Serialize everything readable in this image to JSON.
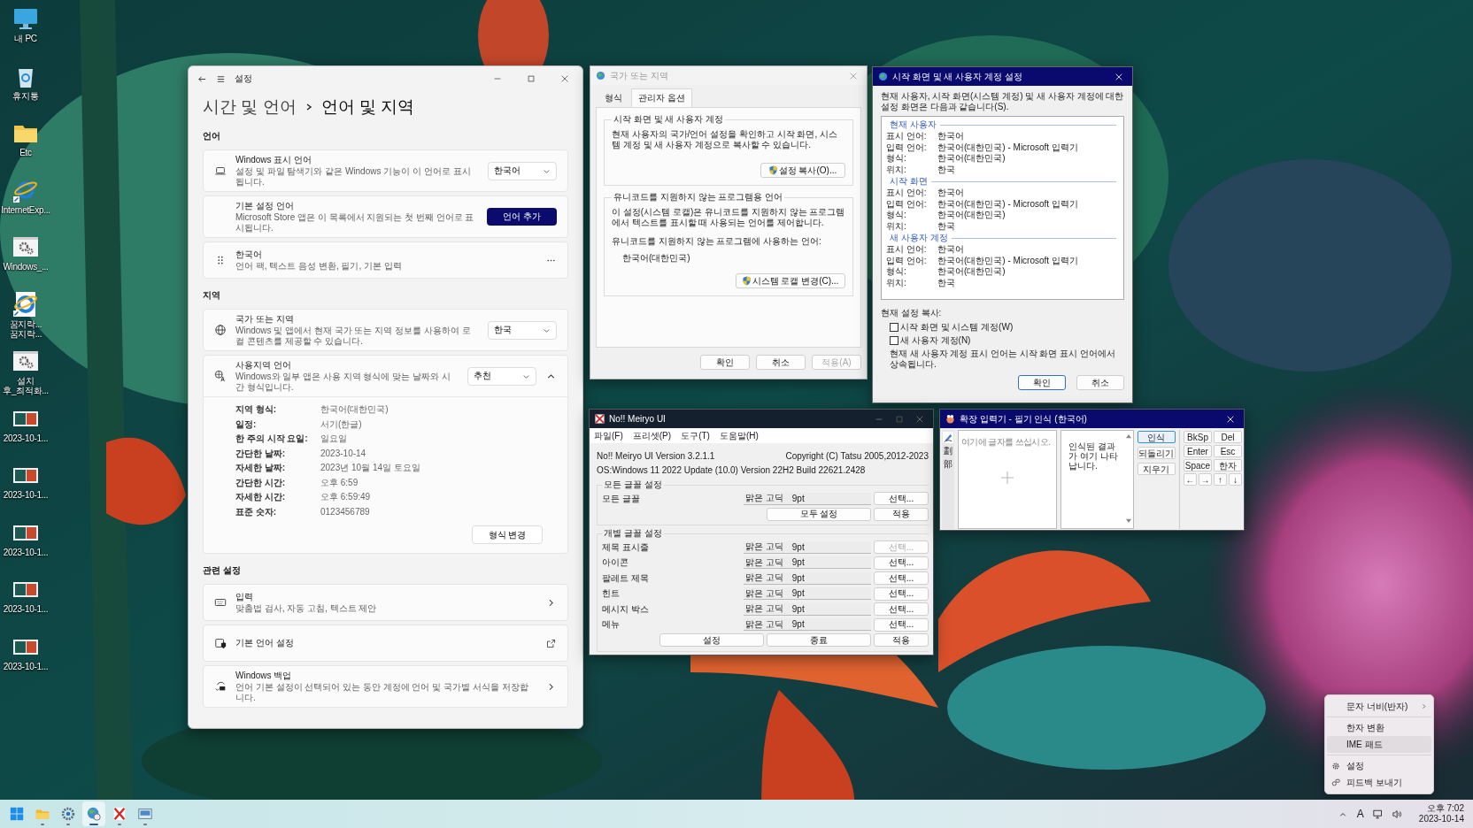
{
  "desktop_icons": [
    {
      "kind": "pc",
      "lines": [
        "내 PC"
      ]
    },
    {
      "kind": "bin",
      "lines": [
        "휴지통"
      ]
    },
    {
      "kind": "folder",
      "lines": [
        "Etc"
      ]
    },
    {
      "kind": "ie",
      "lines": [
        "InternetExp..."
      ]
    },
    {
      "kind": "gear",
      "lines": [
        "Windows_..."
      ]
    },
    {
      "kind": "iedoc",
      "lines": [
        "꿈지락...",
        "꿈지락..."
      ]
    },
    {
      "kind": "gear",
      "lines": [
        "설치",
        "후_최적화..."
      ]
    },
    {
      "kind": "shot",
      "lines": [
        "2023-10-1..."
      ]
    },
    {
      "kind": "shot",
      "lines": [
        "2023-10-1..."
      ]
    },
    {
      "kind": "shot",
      "lines": [
        "2023-10-1..."
      ]
    },
    {
      "kind": "shot",
      "lines": [
        "2023-10-1..."
      ]
    },
    {
      "kind": "shot",
      "lines": [
        "2023-10-1..."
      ]
    }
  ],
  "settings": {
    "title": "설정",
    "breadcrumb": "시간 및 언어",
    "page_title": "언어 및 지역",
    "sections": [
      {
        "heading": "언어",
        "cards": [
          {
            "kind": "dropdown",
            "title": "Windows 표시 언어",
            "desc": "설정 및 파일 탐색기와 같은 Windows 기능이 이 언어로 표시됩니다.",
            "value": "한국어"
          },
          {
            "kind": "button",
            "title": "기본 설정 언어",
            "desc": "Microsoft Store 앱은 이 목록에서 지원되는 첫 번째 언어로 표시됩니다.",
            "button": "언어 추가"
          },
          {
            "kind": "menu",
            "title": "한국어",
            "desc": "언어 팩, 텍스트 음성 변환, 필기, 기본 입력"
          }
        ]
      },
      {
        "heading": "지역",
        "cards": [
          {
            "kind": "dropdown",
            "title": "국가 또는 지역",
            "desc": "Windows 및 앱에서 현재 국가 또는 지역 정보를 사용하여 로컬 콘텐츠를 제공할 수 있습니다.",
            "value": "한국"
          },
          {
            "kind": "expander",
            "title": "사용지역 언어",
            "desc": "Windows와 일부 앱은 사용 지역 형식에 맞는 날짜와 시간 형식입니다.",
            "value": "추천",
            "expanded": true,
            "button": "형식 변경",
            "details": [
              {
                "label": "지역 형식:",
                "value": "한국어(대한민국)"
              },
              {
                "label": "일정:",
                "value": "서기(한글)"
              },
              {
                "label": "한 주의 시작 요일:",
                "value": "일요일"
              },
              {
                "label": "간단한 날짜:",
                "value": "2023-10-14"
              },
              {
                "label": "자세한 날짜:",
                "value": "2023년 10월 14일 토요일"
              },
              {
                "label": "간단한 시간:",
                "value": "오후 6:59"
              },
              {
                "label": "자세한 시간:",
                "value": "오후 6:59:49"
              },
              {
                "label": "표준 숫자:",
                "value": "0123456789"
              }
            ]
          }
        ]
      },
      {
        "heading": "관련 설정",
        "cards": [
          {
            "kind": "link",
            "title": "입력",
            "desc": "맞춤법 검사, 자동 고침, 텍스트 제안"
          },
          {
            "kind": "external",
            "title": "기본 언어 설정"
          },
          {
            "kind": "link",
            "title": "Windows 백업",
            "desc": "언어 기본 설정이 선택되어 있는 동안 계정에 언어 및 국가별 서식을 저장합니다."
          }
        ]
      }
    ]
  },
  "region_dialog": {
    "title": "국가 또는 지역",
    "tabs": [
      {
        "label": "형식",
        "selected": false
      },
      {
        "label": "관리자 옵션",
        "selected": true
      }
    ],
    "group1": {
      "title": "시작 화면 및 새 사용자 계정",
      "text": "현재 사용자의 국가/언어 설정을 확인하고 시작 화면, 시스템 계정 및 새 사용자 계정으로 복사할 수 있습니다.",
      "button": "설정 복사(O)..."
    },
    "group2": {
      "title": "유니코드를 지원하지 않는 프로그램용 언어",
      "text": "이 설정(시스템 로캘)은 유니코드를 지원하지 않는 프로그램에서 텍스트를 표시할 때 사용되는 언어를 제어합니다.",
      "label": "유니코드를 지원하지 않는 프로그램에 사용하는 언어:",
      "value": "한국어(대한민국)",
      "button": "시스템 로캘 변경(C)..."
    },
    "buttons": [
      {
        "label": "확인",
        "disabled": false
      },
      {
        "label": "취소",
        "disabled": false
      },
      {
        "label": "적용(A)",
        "disabled": true
      }
    ]
  },
  "start_dialog": {
    "title": "시작 화면 및 새 사용자 계정 설정",
    "intro": "현재 사용자, 시작 화면(시스템 계정) 및 새 사용자 계정에 대한 설정 화면은 다음과 같습니다(S).",
    "sections": [
      {
        "heading": "현재 사용자",
        "rows": [
          {
            "label": "표시 언어:",
            "value": "한국어"
          },
          {
            "label": "입력 언어:",
            "value": "한국어(대한민국) - Microsoft 입력기"
          },
          {
            "label": "형식:",
            "value": "한국어(대한민국)"
          },
          {
            "label": "위치:",
            "value": "한국"
          }
        ]
      },
      {
        "heading": "시작 화면",
        "rows": [
          {
            "label": "표시 언어:",
            "value": "한국어"
          },
          {
            "label": "입력 언어:",
            "value": "한국어(대한민국) - Microsoft 입력기"
          },
          {
            "label": "형식:",
            "value": "한국어(대한민국)"
          },
          {
            "label": "위치:",
            "value": "한국"
          }
        ]
      },
      {
        "heading": "새 사용자 계정",
        "rows": [
          {
            "label": "표시 언어:",
            "value": "한국어"
          },
          {
            "label": "입력 언어:",
            "value": "한국어(대한민국) - Microsoft 입력기"
          },
          {
            "label": "형식:",
            "value": "한국어(대한민국)"
          },
          {
            "label": "위치:",
            "value": "한국"
          }
        ]
      }
    ],
    "copy_label": "현재 설정 복사:",
    "checkboxes": [
      {
        "label": "시작 화면 및 시스템 계정(W)",
        "checked": false
      },
      {
        "label": "새 사용자 계정(N)",
        "checked": false
      }
    ],
    "note": "현재 새 사용자 계정 표시 언어는 시작 화면 표시 언어에서 상속됩니다.",
    "buttons": [
      {
        "label": "확인",
        "default": true
      },
      {
        "label": "취소",
        "default": false
      }
    ]
  },
  "meiryo": {
    "title": "No!! Meiryo UI",
    "menu": [
      "파일(F)",
      "프리셋(P)",
      "도구(T)",
      "도움말(H)"
    ],
    "version": "No!! Meiryo UI Version 3.2.1.1",
    "copyright": "Copyright (C) Tatsu 2005,2012-2023",
    "os": "OS:Windows 11 2022 Update (10.0) Version 22H2 Build 22621.2428",
    "all_group": {
      "title": "모든 글꼴 설정",
      "label": "모든 글꼴",
      "font": "맑은 고딕",
      "size": "9pt",
      "select": "선택...",
      "set_all": "모두 설정",
      "apply": "적용"
    },
    "each_group": {
      "title": "개별 글꼴 설정",
      "rows": [
        {
          "label": "제목 표시줄",
          "font": "맑은 고딕",
          "size": "9pt",
          "button": "선택...",
          "disabled": true
        },
        {
          "label": "아이콘",
          "font": "맑은 고딕",
          "size": "9pt",
          "button": "선택...",
          "disabled": false
        },
        {
          "label": "팔레트 제목",
          "font": "맑은 고딕",
          "size": "9pt",
          "button": "선택...",
          "disabled": false
        },
        {
          "label": "힌트",
          "font": "맑은 고딕",
          "size": "9pt",
          "button": "선택...",
          "disabled": false
        },
        {
          "label": "메시지 박스",
          "font": "맑은 고딕",
          "size": "9pt",
          "button": "선택...",
          "disabled": false
        },
        {
          "label": "메뉴",
          "font": "맑은 고딕",
          "size": "9pt",
          "button": "선택...",
          "disabled": false
        }
      ]
    },
    "footer": [
      "설정",
      "종료",
      "적용"
    ]
  },
  "ime_pad": {
    "title": "확장 입력기 - 필기 인식 (한국어)",
    "side_tabs": [
      {
        "kind": "pen",
        "selected": true
      },
      {
        "kind": "text",
        "label": "劃",
        "selected": false
      },
      {
        "kind": "text",
        "label": "部",
        "selected": false
      }
    ],
    "placeholder": "여기에 글자를 쓰십시오.",
    "result": "인식된 결과가 여기 나타납니다.",
    "actions": [
      {
        "label": "인식",
        "default": true
      },
      {
        "label": "되돌리기",
        "default": false
      },
      {
        "label": "지우기",
        "default": false
      }
    ],
    "keys": [
      {
        "label": "BkSp",
        "kind": "wide"
      },
      {
        "label": "Del",
        "kind": "wide"
      },
      {
        "label": "Enter",
        "kind": "wide"
      },
      {
        "label": "Esc",
        "kind": "wide"
      },
      {
        "label": "Space",
        "kind": "wide"
      },
      {
        "label": "한자",
        "kind": "wide"
      },
      {
        "label": "←",
        "kind": "arrow"
      },
      {
        "label": "→",
        "kind": "arrow"
      },
      {
        "label": "↑",
        "kind": "arrow"
      },
      {
        "label": "↓",
        "kind": "arrow"
      }
    ]
  },
  "ime_menu": {
    "items": [
      {
        "kind": "submenu",
        "label": "문자 너비(반자)",
        "selected": false
      },
      {
        "kind": "plain",
        "label": "한자 변환",
        "selected": false
      },
      {
        "kind": "plain",
        "label": "IME 패드",
        "selected": true
      },
      {
        "kind": "settings",
        "label": "설정",
        "selected": false
      },
      {
        "kind": "feedback",
        "label": "피드백 보내기",
        "selected": false
      }
    ]
  },
  "taskbar": {
    "apps": [
      {
        "kind": "start",
        "running": false,
        "selected": false
      },
      {
        "kind": "explorer",
        "running": true,
        "selected": false
      },
      {
        "kind": "settings",
        "running": true,
        "selected": false
      },
      {
        "kind": "region",
        "running": true,
        "selected": true
      },
      {
        "kind": "meiryo",
        "running": true,
        "selected": false
      },
      {
        "kind": "ime",
        "running": true,
        "selected": false
      }
    ],
    "input_indicator": "A",
    "time": "오후 7:02",
    "date": "2023-10-14"
  }
}
